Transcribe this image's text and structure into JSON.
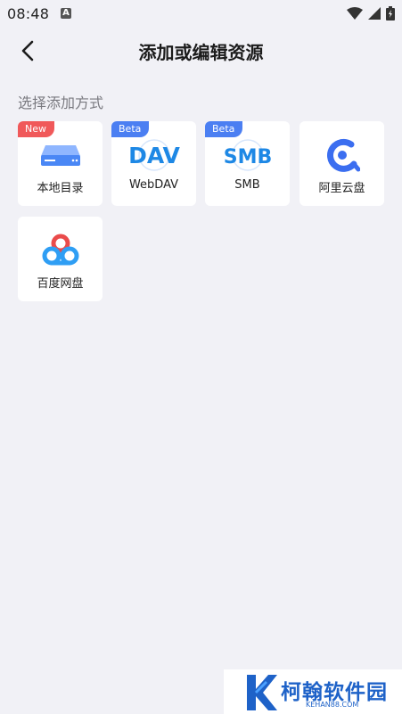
{
  "status_bar": {
    "time": "08:48",
    "notification_badge": "A"
  },
  "header": {
    "title": "添加或编辑资源"
  },
  "section": {
    "label": "选择添加方式"
  },
  "sources": [
    {
      "label": "本地目录",
      "badge": "New",
      "icon": "hard-drive-icon"
    },
    {
      "label": "WebDAV",
      "badge": "Beta",
      "icon": "dav-icon",
      "icon_text": "DAV"
    },
    {
      "label": "SMB",
      "badge": "Beta",
      "icon": "smb-icon",
      "icon_text": "SMB"
    },
    {
      "label": "阿里云盘",
      "badge": "",
      "icon": "aliyun-drive-icon"
    },
    {
      "label": "百度网盘",
      "badge": "",
      "icon": "baidu-netdisk-icon"
    }
  ],
  "watermark": {
    "text": "柯翰软件园",
    "sub": "KEHAN88.COM"
  },
  "colors": {
    "background": "#f1f1f6",
    "badge_new": "#f0595a",
    "badge_beta": "#4b7ff2",
    "accent_blue": "#1e88e5"
  }
}
